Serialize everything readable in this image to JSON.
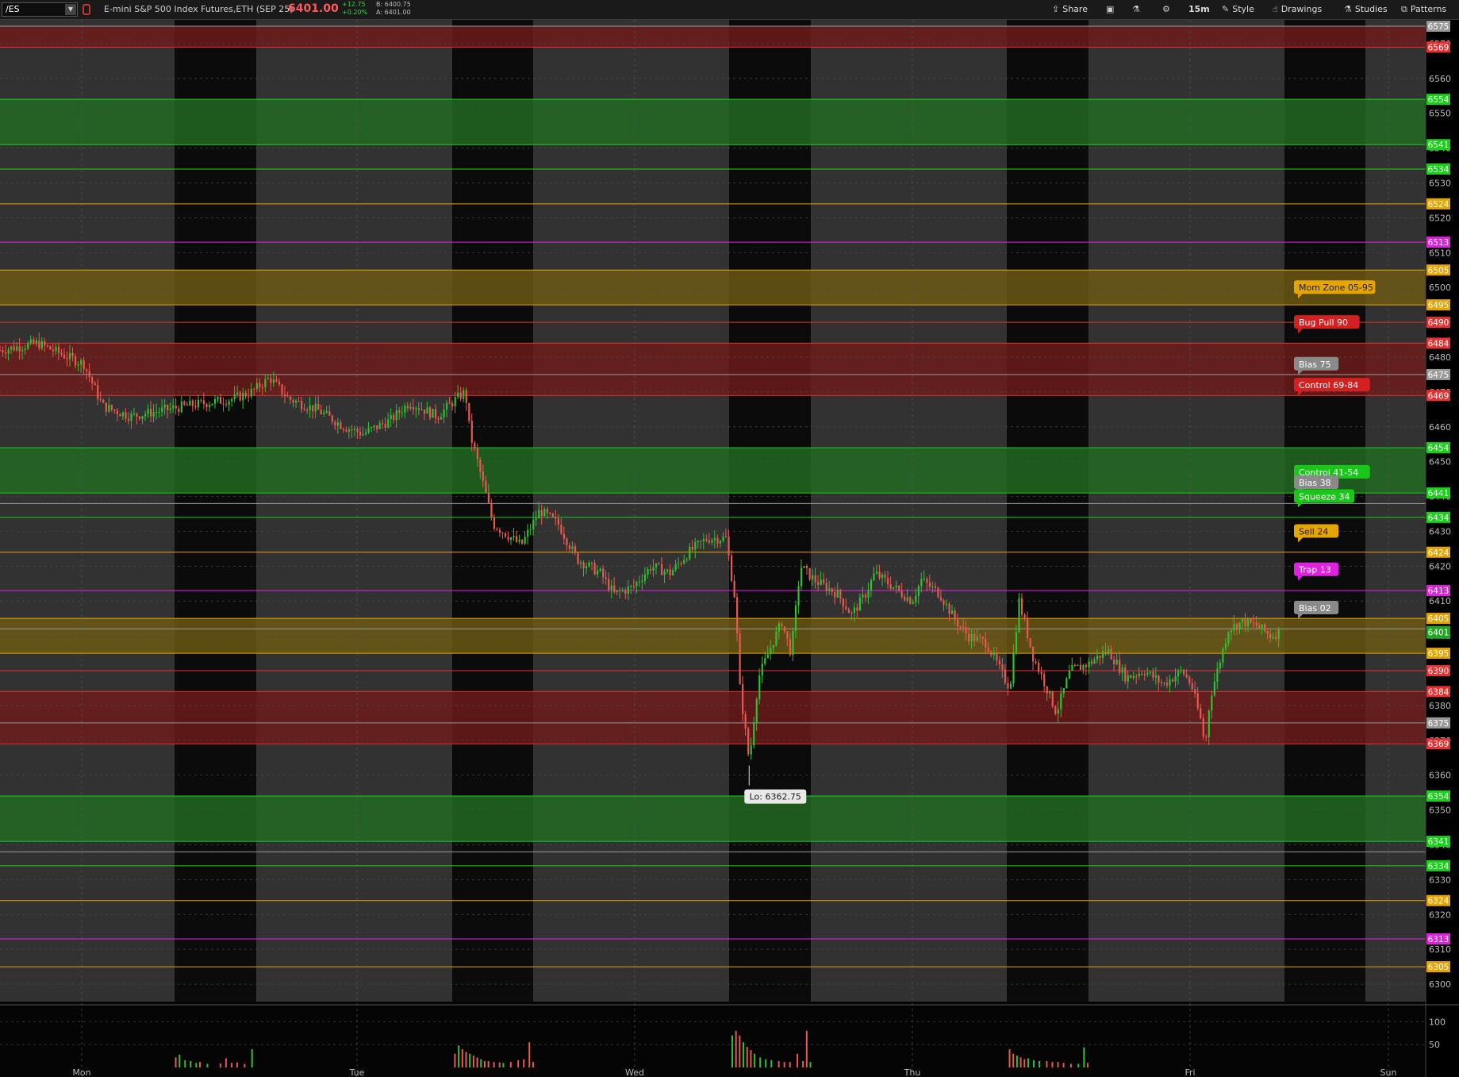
{
  "toolbar": {
    "symbol": "/ES",
    "description": "E-mini S&P 500 Index Futures,ETH (SEP 25)",
    "last": "6401.00",
    "net_change": "+12.75",
    "pct_change": "+0.20%",
    "bid": "B: 6400.75",
    "ask": "A: 6401.00",
    "share": "Share",
    "timeframe": "15m",
    "style": "Style",
    "drawings": "Drawings",
    "studies": "Studies",
    "patterns": "Patterns"
  },
  "chart_data": {
    "type": "candlestick",
    "ylim": [
      6295,
      6575
    ],
    "y_ticks": [
      6300,
      6310,
      6320,
      6330,
      6340,
      6350,
      6360,
      6370,
      6380,
      6390,
      6400,
      6410,
      6420,
      6430,
      6440,
      6450,
      6460,
      6470,
      6480,
      6490,
      6500,
      6510,
      6520,
      6530,
      6540,
      6550,
      6560,
      6570
    ],
    "days": [
      "Mon",
      "Tue",
      "Wed",
      "Thu",
      "Fri",
      "Sun"
    ],
    "grid": true,
    "zones": [
      {
        "from": 6569,
        "to": 6575,
        "color": "#6e1a1a"
      },
      {
        "from": 6541,
        "to": 6554,
        "color": "#226a22"
      },
      {
        "from": 6495,
        "to": 6505,
        "color": "#6f5a12"
      },
      {
        "from": 6469,
        "to": 6484,
        "color": "#6e1a1a"
      },
      {
        "from": 6441,
        "to": 6454,
        "color": "#226a22"
      },
      {
        "from": 6395,
        "to": 6405,
        "color": "#6f5a12"
      },
      {
        "from": 6369,
        "to": 6384,
        "color": "#6e1a1a"
      },
      {
        "from": 6341,
        "to": 6354,
        "color": "#226a22"
      }
    ],
    "levels": [
      {
        "value": 6575,
        "label": "6575",
        "color": "#999999"
      },
      {
        "value": 6569,
        "label": "6569",
        "color": "#e83030"
      },
      {
        "value": 6554,
        "label": "6554",
        "color": "#19d119"
      },
      {
        "value": 6541,
        "label": "6541",
        "color": "#19d119"
      },
      {
        "value": 6534,
        "label": "6534",
        "color": "#19d119"
      },
      {
        "value": 6524,
        "label": "6524",
        "color": "#e6a400"
      },
      {
        "value": 6513,
        "label": "6513",
        "color": "#e021e0"
      },
      {
        "value": 6505,
        "label": "6505",
        "color": "#e6a400"
      },
      {
        "value": 6495,
        "label": "6495",
        "color": "#e6a400"
      },
      {
        "value": 6490,
        "label": "6490",
        "color": "#e83030"
      },
      {
        "value": 6484,
        "label": "6484",
        "color": "#e83030"
      },
      {
        "value": 6475,
        "label": "6475",
        "color": "#999999"
      },
      {
        "value": 6469,
        "label": "6469",
        "color": "#e83030"
      },
      {
        "value": 6454,
        "label": "6454",
        "color": "#19d119"
      },
      {
        "value": 6441,
        "label": "6441",
        "color": "#19d119"
      },
      {
        "value": 6438,
        "label": "",
        "color": "#999999"
      },
      {
        "value": 6434,
        "label": "6434",
        "color": "#19d119"
      },
      {
        "value": 6424,
        "label": "6424",
        "color": "#e6a400"
      },
      {
        "value": 6413,
        "label": "6413",
        "color": "#e021e0"
      },
      {
        "value": 6405,
        "label": "6405",
        "color": "#e6a400"
      },
      {
        "value": 6402,
        "label": "",
        "color": "#999999"
      },
      {
        "value": 6395,
        "label": "6395",
        "color": "#e6a400"
      },
      {
        "value": 6390,
        "label": "6390",
        "color": "#e83030"
      },
      {
        "value": 6384,
        "label": "6384",
        "color": "#e83030"
      },
      {
        "value": 6375,
        "label": "6375",
        "color": "#999999"
      },
      {
        "value": 6369,
        "label": "6369",
        "color": "#e83030"
      },
      {
        "value": 6354,
        "label": "6354",
        "color": "#19d119"
      },
      {
        "value": 6341,
        "label": "6341",
        "color": "#19d119"
      },
      {
        "value": 6338,
        "label": "",
        "color": "#999999"
      },
      {
        "value": 6334,
        "label": "6334",
        "color": "#19d119"
      },
      {
        "value": 6324,
        "label": "6324",
        "color": "#e6a400"
      },
      {
        "value": 6313,
        "label": "6313",
        "color": "#e021e0"
      },
      {
        "value": 6305,
        "label": "6305",
        "color": "#e6a400"
      }
    ],
    "last_price": {
      "value": 6401,
      "label": "6401",
      "color": "#21a621"
    },
    "annotations": [
      {
        "text": "Mom Zone 05-95",
        "value": 6500,
        "color": "#e6a400",
        "text_color": "#222222"
      },
      {
        "text": "Bug Pull 90",
        "value": 6490,
        "color": "#d42020",
        "text_color": "#ffffff"
      },
      {
        "text": "Bias 75",
        "value": 6478,
        "color": "#8a8a8a",
        "text_color": "#ffffff"
      },
      {
        "text": "Control 69-84",
        "value": 6472,
        "color": "#d42020",
        "text_color": "#ffffff"
      },
      {
        "text": "Control 41-54",
        "value": 6447,
        "color": "#19c719",
        "text_color": "#ffffff"
      },
      {
        "text": "Bias 38",
        "value": 6444,
        "color": "#8a8a8a",
        "text_color": "#ffffff"
      },
      {
        "text": "Squeeze 34",
        "value": 6440,
        "color": "#19c719",
        "text_color": "#ffffff"
      },
      {
        "text": "Sell 24",
        "value": 6430,
        "color": "#e6a400",
        "text_color": "#222222"
      },
      {
        "text": "Trap 13",
        "value": 6419,
        "color": "#e021e0",
        "text_color": "#ffffff"
      },
      {
        "text": "Bias 02",
        "value": 6408,
        "color": "#8a8a8a",
        "text_color": "#ffffff"
      }
    ],
    "low_label": "Lo: 6362.75",
    "low_value": 6362.75,
    "price_path": [
      [
        0,
        6482
      ],
      [
        40,
        6484
      ],
      [
        90,
        6478
      ],
      [
        110,
        6466
      ],
      [
        140,
        6463
      ],
      [
        200,
        6466
      ],
      [
        250,
        6468
      ],
      [
        270,
        6470
      ],
      [
        290,
        6474
      ],
      [
        310,
        6468
      ],
      [
        340,
        6465
      ],
      [
        370,
        6460
      ],
      [
        390,
        6458
      ],
      [
        420,
        6462
      ],
      [
        440,
        6467
      ],
      [
        470,
        6463
      ],
      [
        490,
        6468
      ],
      [
        500,
        6470
      ],
      [
        505,
        6458
      ],
      [
        515,
        6448
      ],
      [
        530,
        6432
      ],
      [
        560,
        6426
      ],
      [
        580,
        6436
      ],
      [
        600,
        6432
      ],
      [
        620,
        6422
      ],
      [
        645,
        6418
      ],
      [
        660,
        6412
      ],
      [
        680,
        6414
      ],
      [
        700,
        6420
      ],
      [
        720,
        6418
      ],
      [
        740,
        6424
      ],
      [
        760,
        6428
      ],
      [
        780,
        6428
      ],
      [
        790,
        6410
      ],
      [
        795,
        6385
      ],
      [
        805,
        6364
      ],
      [
        815,
        6388
      ],
      [
        830,
        6398
      ],
      [
        840,
        6404
      ],
      [
        850,
        6395
      ],
      [
        860,
        6420
      ],
      [
        875,
        6416
      ],
      [
        900,
        6412
      ],
      [
        915,
        6406
      ],
      [
        930,
        6412
      ],
      [
        940,
        6418
      ],
      [
        960,
        6414
      ],
      [
        980,
        6410
      ],
      [
        990,
        6416
      ],
      [
        1010,
        6412
      ],
      [
        1025,
        6405
      ],
      [
        1040,
        6400
      ],
      [
        1060,
        6398
      ],
      [
        1075,
        6390
      ],
      [
        1085,
        6385
      ],
      [
        1095,
        6410
      ],
      [
        1110,
        6394
      ],
      [
        1120,
        6388
      ],
      [
        1135,
        6378
      ],
      [
        1150,
        6390
      ],
      [
        1170,
        6392
      ],
      [
        1190,
        6396
      ],
      [
        1210,
        6388
      ],
      [
        1230,
        6390
      ],
      [
        1250,
        6386
      ],
      [
        1270,
        6390
      ],
      [
        1280,
        6386
      ],
      [
        1290,
        6376
      ],
      [
        1295,
        6368
      ],
      [
        1300,
        6382
      ],
      [
        1310,
        6392
      ],
      [
        1320,
        6402
      ],
      [
        1335,
        6404
      ],
      [
        1350,
        6403
      ],
      [
        1365,
        6400
      ],
      [
        1376,
        6401
      ]
    ],
    "volume": {
      "ylim": [
        0,
        130
      ],
      "y_ticks": [
        50,
        100
      ],
      "bars": [
        [
          188,
          22
        ],
        [
          192,
          28
        ],
        [
          198,
          16
        ],
        [
          204,
          14
        ],
        [
          210,
          10
        ],
        [
          214,
          12
        ],
        [
          222,
          8
        ],
        [
          236,
          9
        ],
        [
          242,
          20
        ],
        [
          248,
          10
        ],
        [
          254,
          11
        ],
        [
          262,
          8
        ],
        [
          270,
          40
        ],
        [
          488,
          30
        ],
        [
          492,
          48
        ],
        [
          496,
          40
        ],
        [
          500,
          34
        ],
        [
          504,
          30
        ],
        [
          508,
          26
        ],
        [
          512,
          22
        ],
        [
          516,
          18
        ],
        [
          520,
          14
        ],
        [
          524,
          14
        ],
        [
          530,
          12
        ],
        [
          536,
          11
        ],
        [
          540,
          10
        ],
        [
          548,
          12
        ],
        [
          556,
          16
        ],
        [
          562,
          18
        ],
        [
          568,
          55
        ],
        [
          572,
          12
        ],
        [
          786,
          70
        ],
        [
          790,
          80
        ],
        [
          794,
          70
        ],
        [
          798,
          55
        ],
        [
          802,
          45
        ],
        [
          806,
          38
        ],
        [
          810,
          30
        ],
        [
          816,
          22
        ],
        [
          822,
          18
        ],
        [
          828,
          16
        ],
        [
          836,
          14
        ],
        [
          842,
          12
        ],
        [
          848,
          12
        ],
        [
          856,
          30
        ],
        [
          862,
          14
        ],
        [
          866,
          80
        ],
        [
          870,
          12
        ],
        [
          1084,
          40
        ],
        [
          1088,
          30
        ],
        [
          1092,
          26
        ],
        [
          1096,
          22
        ],
        [
          1100,
          18
        ],
        [
          1104,
          20
        ],
        [
          1110,
          16
        ],
        [
          1116,
          14
        ],
        [
          1124,
          14
        ],
        [
          1130,
          12
        ],
        [
          1136,
          12
        ],
        [
          1142,
          10
        ],
        [
          1150,
          8
        ],
        [
          1158,
          8
        ],
        [
          1164,
          44
        ],
        [
          1168,
          10
        ]
      ]
    }
  }
}
